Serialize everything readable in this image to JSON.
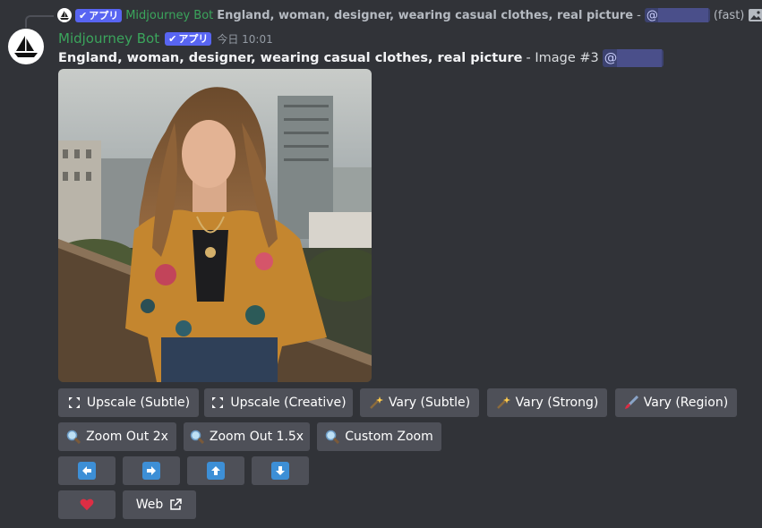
{
  "reply": {
    "badge": "アプリ",
    "name": "Midjourney Bot",
    "prompt": "England, woman, designer, wearing casual clothes, real picture",
    "separator": "-",
    "mention_at": "@",
    "speed": "(fast)"
  },
  "message": {
    "author": "Midjourney Bot",
    "badge": "アプリ",
    "timestamp": "今日 10:01",
    "prompt": "England, woman, designer, wearing casual clothes, real picture",
    "suffix": "- Image #3",
    "mention_at": "@"
  },
  "buttons": {
    "upscale_subtle": "Upscale (Subtle)",
    "upscale_creative": "Upscale (Creative)",
    "vary_subtle": "Vary (Subtle)",
    "vary_strong": "Vary (Strong)",
    "vary_region": "Vary (Region)",
    "zoom_out_2x": "Zoom Out 2x",
    "zoom_out_1_5x": "Zoom Out 1.5x",
    "custom_zoom": "Custom Zoom",
    "web": "Web"
  },
  "icons": {
    "upscale": "expand-arrows-icon",
    "vary": "magic-wand-icon",
    "region": "paintbrush-icon",
    "zoom": "magnifier-icon",
    "pan_left": "arrow-left-icon",
    "pan_right": "arrow-right-icon",
    "pan_up": "arrow-up-icon",
    "pan_down": "arrow-down-icon",
    "favorite": "heart-icon",
    "external": "external-link-icon"
  },
  "colors": {
    "background": "#313338",
    "button": "#4e5058",
    "bot_name": "#3ba55c",
    "badge": "#5865f2",
    "arrow": "#3d8fd6",
    "heart": "#dd2e44"
  }
}
